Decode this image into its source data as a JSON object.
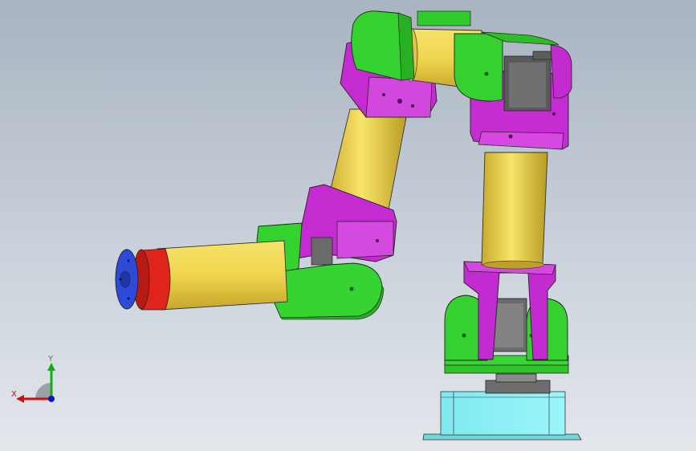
{
  "triad": {
    "x_label": "X",
    "y_label": "Y",
    "x_color": "#d01010",
    "y_color": "#10b010",
    "z_color": "#1010d0"
  },
  "colors": {
    "link_yellow": "#f2dc5a",
    "bracket_magenta": "#cc2fd6",
    "cover_green": "#33d42e",
    "servo_gray": "#6f6f6f",
    "base_cyan": "#87f2f7",
    "flange_blue": "#2b49d8",
    "flange_red": "#e2231a",
    "background": "#b9c3ce"
  }
}
